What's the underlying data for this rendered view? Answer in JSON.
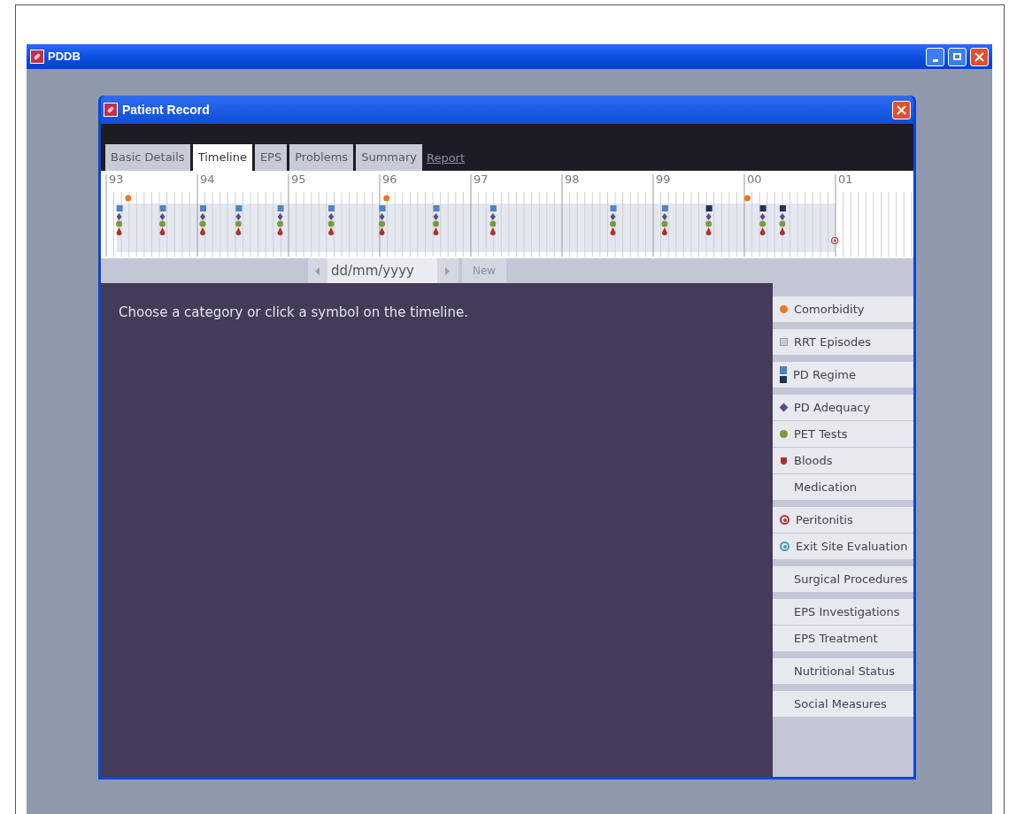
{
  "app_window": {
    "title": "PDDB"
  },
  "record_window": {
    "title": "Patient Record"
  },
  "tabs": [
    {
      "label": "Basic Details",
      "selected": false
    },
    {
      "label": "Timeline",
      "selected": true
    },
    {
      "label": "EPS",
      "selected": false
    },
    {
      "label": "Problems",
      "selected": false
    },
    {
      "label": "Summary",
      "selected": false
    }
  ],
  "report_link": "Report",
  "timeline": {
    "years": [
      "93",
      "94",
      "95",
      "96",
      "97",
      "98",
      "99",
      "00",
      "01"
    ],
    "events": [
      {
        "kind": "visit"
      },
      {
        "kind": "visit"
      },
      {
        "kind": "visit"
      },
      {
        "kind": "visit"
      },
      {
        "kind": "visit"
      },
      {
        "kind": "visit"
      },
      {
        "kind": "visit"
      },
      {
        "kind": "visit"
      },
      {
        "kind": "visit"
      },
      {
        "kind": "visit"
      },
      {
        "kind": "visit"
      },
      {
        "kind": "change"
      },
      {
        "kind": "change"
      },
      {
        "kind": "change"
      },
      {
        "kind": "comorbidity"
      },
      {
        "kind": "comorbidity"
      },
      {
        "kind": "comorbidity"
      },
      {
        "kind": "peritonitis"
      }
    ]
  },
  "date_nav": {
    "placeholder": "dd/mm/yyyy",
    "new_button": {
      "label": "New",
      "disabled": true
    }
  },
  "message": "Choose a category or click a symbol on the timeline.",
  "categories": [
    [
      {
        "label": "Comorbidity",
        "kind": "dot",
        "color": "#e87722"
      }
    ],
    [
      {
        "label": "RRT Episodes",
        "kind": "square",
        "color": "#c5cad6"
      }
    ],
    [
      {
        "label": "PD Regime",
        "kind": "regime",
        "color": "#4a86c0"
      }
    ],
    [
      {
        "label": "PD Adequacy",
        "kind": "diamond",
        "color": "#5b4a8a"
      },
      {
        "label": "PET Tests",
        "kind": "dot",
        "color": "#7a9a3a"
      },
      {
        "label": "Bloods",
        "kind": "drop",
        "color": "#a83232"
      },
      {
        "label": "Medication",
        "kind": "none"
      }
    ],
    [
      {
        "label": "Peritonitis",
        "kind": "ring",
        "color": "#b03a3a"
      },
      {
        "label": "Exit Site Evaluation",
        "kind": "ring",
        "color": "#3aa0c0"
      }
    ],
    [
      {
        "label": "Surgical Procedures",
        "kind": "none"
      }
    ],
    [
      {
        "label": "EPS Investigations",
        "kind": "none"
      },
      {
        "label": "EPS Treatment",
        "kind": "none"
      }
    ],
    [
      {
        "label": "Nutritional Status",
        "kind": "none"
      }
    ],
    [
      {
        "label": "Social Measures",
        "kind": "none"
      }
    ]
  ]
}
